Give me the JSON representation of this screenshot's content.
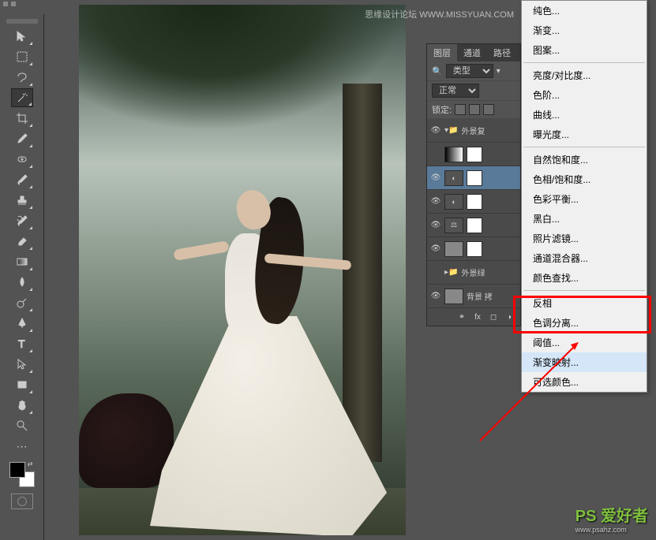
{
  "watermark": {
    "top": "思缘设计论坛  WWW.MISSYUAN.COM",
    "bottom_main": "PS 爱好者",
    "bottom_sub": "www.psahz.com"
  },
  "toolbar": {
    "tools": [
      "move-tool",
      "marquee-tool",
      "lasso-tool",
      "magic-wand-tool",
      "crop-tool",
      "eyedropper-tool",
      "healing-brush-tool",
      "brush-tool",
      "stamp-tool",
      "history-brush-tool",
      "eraser-tool",
      "gradient-tool",
      "blur-tool",
      "dodge-tool",
      "pen-tool",
      "type-tool",
      "path-selection-tool",
      "rectangle-tool",
      "hand-tool",
      "zoom-tool"
    ],
    "selected": "magic-wand-tool"
  },
  "layers_panel": {
    "tabs": {
      "layers": "图层",
      "channels": "通道",
      "paths": "路径"
    },
    "filter_label": "类型",
    "blend_mode": "正常",
    "lock_label": "锁定:",
    "layers": [
      {
        "name": "外景复",
        "type": "group",
        "visible": true
      },
      {
        "name": "",
        "type": "gradient-map",
        "visible": false
      },
      {
        "name": "",
        "type": "adjustment",
        "visible": true,
        "selected": true
      },
      {
        "name": "",
        "type": "adjustment",
        "visible": true
      },
      {
        "name": "",
        "type": "adjustment",
        "visible": true
      },
      {
        "name": "",
        "type": "image-mask",
        "visible": true
      },
      {
        "name": "外景绿",
        "type": "group",
        "visible": false
      },
      {
        "name": "背景 拷",
        "type": "image",
        "visible": true
      }
    ],
    "footer_icons": [
      "link",
      "fx",
      "mask",
      "adjustment"
    ]
  },
  "context_menu": {
    "items": [
      {
        "label": "纯色...",
        "sep": false
      },
      {
        "label": "渐变...",
        "sep": false
      },
      {
        "label": "图案...",
        "sep": true
      },
      {
        "label": "亮度/对比度...",
        "sep": false
      },
      {
        "label": "色阶...",
        "sep": false
      },
      {
        "label": "曲线...",
        "sep": false
      },
      {
        "label": "曝光度...",
        "sep": true
      },
      {
        "label": "自然饱和度...",
        "sep": false
      },
      {
        "label": "色相/饱和度...",
        "sep": false
      },
      {
        "label": "色彩平衡...",
        "sep": false
      },
      {
        "label": "黑白...",
        "sep": false
      },
      {
        "label": "照片滤镜...",
        "sep": false
      },
      {
        "label": "通道混合器...",
        "sep": false
      },
      {
        "label": "颜色查找...",
        "sep": true
      },
      {
        "label": "反相",
        "sep": false
      },
      {
        "label": "色调分离...",
        "sep": false
      },
      {
        "label": "阈值...",
        "sep": false
      },
      {
        "label": "渐变映射...",
        "sep": false,
        "highlighted": true
      },
      {
        "label": "可选颜色...",
        "sep": false
      }
    ]
  }
}
